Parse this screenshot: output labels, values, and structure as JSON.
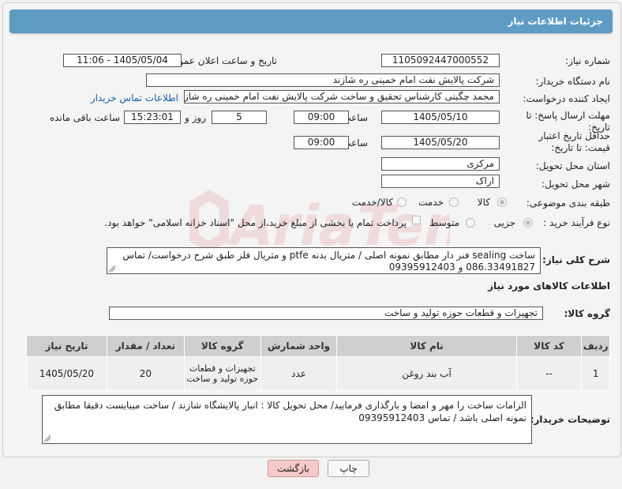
{
  "header": {
    "title": "جزئیات اطلاعات نیاز"
  },
  "fields": {
    "need_number_label": "شماره نیاز:",
    "need_number": "1105092447000552",
    "announce_label": "تاریخ و ساعت اعلان عمومی:",
    "announce_value": "1405/05/04 - 11:06",
    "buyer_org_label": "نام دستگاه خریدار:",
    "buyer_org": "شرکت پالایش نفت امام خمینی  ره  شازند",
    "requester_label": "ایجاد کننده درخواست:",
    "requester": "محمد چگینی کارشناس تحقیق و ساخت  شرکت پالایش نفت امام خمینی  ره  شازند",
    "buyer_contact_link": "اطلاعات تماس خریدار",
    "deadline_label": "مهلت ارسال پاسخ: تا تاریخ:",
    "deadline_date": "1405/05/10",
    "time_label": "ساعت",
    "deadline_time": "09:00",
    "days_value": "5",
    "days_label": "روز و",
    "remaining_time": "15:23:01",
    "remaining_label": "ساعت باقی مانده",
    "validity_label": "حداقل تاریخ اعتبار قیمت: تا تاریخ:",
    "validity_date": "1405/05/20",
    "validity_time": "09:00",
    "province_label": "استان محل تحویل:",
    "province": "مرکزی",
    "city_label": "شهر محل تحویل:",
    "city": "اراک",
    "category_label": "طبقه بندی موضوعی:",
    "category_options": [
      "کالا",
      "خدمت",
      "کالا/خدمت"
    ],
    "purchase_type_label": "نوع فرآیند خرید :",
    "purchase_options": [
      "جزیی",
      "متوسط"
    ],
    "payment_note": "پرداخت تمام یا بخشی از مبلغ خرید،از محل \"اسناد خزانه اسلامی\" خواهد بود."
  },
  "description": {
    "label": "شرح کلی نیاز:",
    "text": "ساخت sealing فنر دار مطابق نمونه اصلی / متریال بدنه ptfe و متریال فلز طبق شرح درخواست/ تماس 086.33491827 و 09395912403"
  },
  "goods_info": {
    "title": "اطلاعات کالاهای مورد نیاز",
    "group_label": "گروه کالا:",
    "group_value": "تجهیزات و قطعات حوزه تولید و ساخت"
  },
  "table": {
    "headers": [
      "ردیف",
      "کد کالا",
      "نام کالا",
      "واحد شمارش",
      "گروه کالا",
      "تعداد / مقدار",
      "تاریخ نیاز"
    ],
    "rows": [
      [
        "1",
        "--",
        "آب بند روغن",
        "عدد",
        "تجهیزات و قطعات حوزه تولید و ساخت",
        "20",
        "1405/05/20"
      ]
    ]
  },
  "buyer_notes": {
    "label": "توضیحات خریدار:",
    "text": "الزامات ساخت را مهر و امضا و بارگذاری فرمایید/ محل تحویل کالا : انبار پالایشگاه شازند / ساخت میبایست دقیقا مطابق نمونه اصلی باشد / تماس 09395912403"
  },
  "buttons": {
    "print": "چاپ",
    "back": "بازگشت"
  },
  "colors": {
    "header": "#5e9cc4",
    "back_button": "#f7c9c9",
    "link": "#1a5ea8"
  }
}
